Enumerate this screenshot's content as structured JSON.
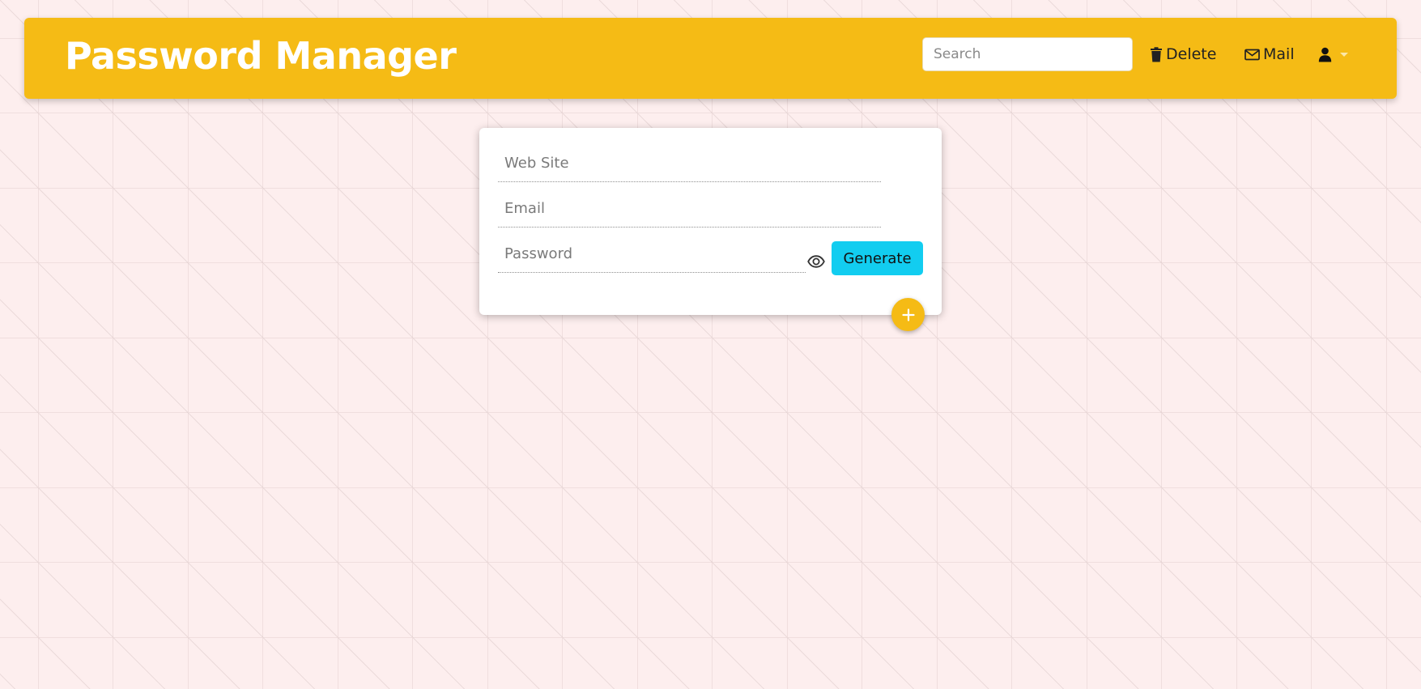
{
  "app": {
    "title": "Password Manager",
    "accent_color": "#f5bb15",
    "background_color": "#fdeeee"
  },
  "header": {
    "search_placeholder": "Search",
    "delete_label": "Delete",
    "delete_icon": "trash-icon",
    "mail_label": "Mail",
    "mail_icon": "envelope-icon",
    "user_icon": "user-icon",
    "user_menu_icon": "caret-down-icon"
  },
  "form": {
    "website_placeholder": "Web Site",
    "email_placeholder": "Email",
    "password_placeholder": "Password",
    "show_password_icon": "eye-icon",
    "generate_label": "Generate",
    "generate_color": "#12cdf0",
    "add_icon": "plus-icon"
  }
}
